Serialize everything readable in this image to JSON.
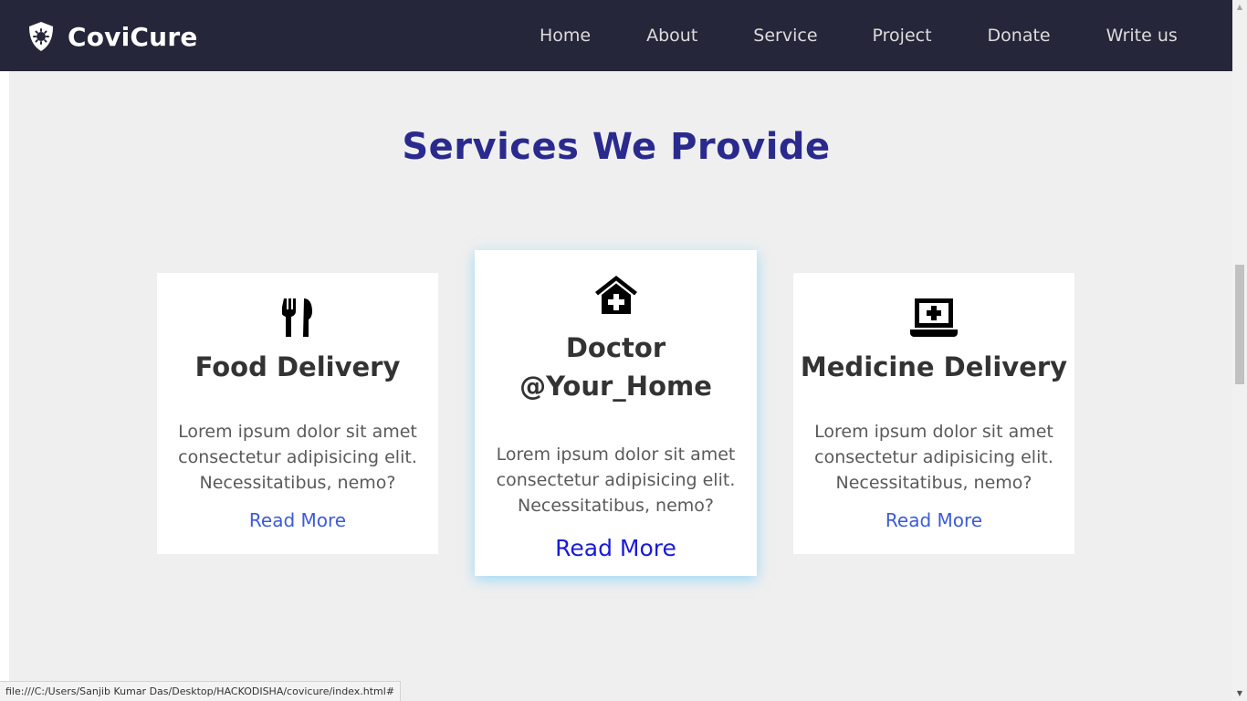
{
  "brand": {
    "name": "CoviCure",
    "icon": "shield-virus-icon"
  },
  "nav": {
    "home": "Home",
    "about": "About",
    "service": "Service",
    "project": "Project",
    "donate": "Donate",
    "write_us": "Write us"
  },
  "section": {
    "title": "Services We Provide"
  },
  "cards": [
    {
      "icon": "utensils-icon",
      "title": "Food Delivery",
      "text": "Lorem ipsum dolor sit amet consectetur adipisicing elit. Necessitatibus, nemo?",
      "link": "Read More"
    },
    {
      "icon": "clinic-house-icon",
      "title": "Doctor @Your_Home",
      "text": "Lorem ipsum dolor sit amet consectetur adipisicing elit. Necessitatibus, nemo?",
      "link": "Read More"
    },
    {
      "icon": "laptop-medical-icon",
      "title": "Medicine Delivery",
      "text": "Lorem ipsum dolor sit amet consectetur adipisicing elit. Necessitatibus, nemo?",
      "link": "Read More"
    }
  ],
  "status_url": "file:///C:/Users/Sanjib Kumar Das/Desktop/HACKODISHA/covicure/index.html#",
  "colors": {
    "navbar_bg": "#26263a",
    "page_bg": "#efefef",
    "title": "#2a2a8e",
    "link": "#3d5bd6",
    "link_hover": "#1a1ad9",
    "card_glow": "#5ac8ff"
  }
}
